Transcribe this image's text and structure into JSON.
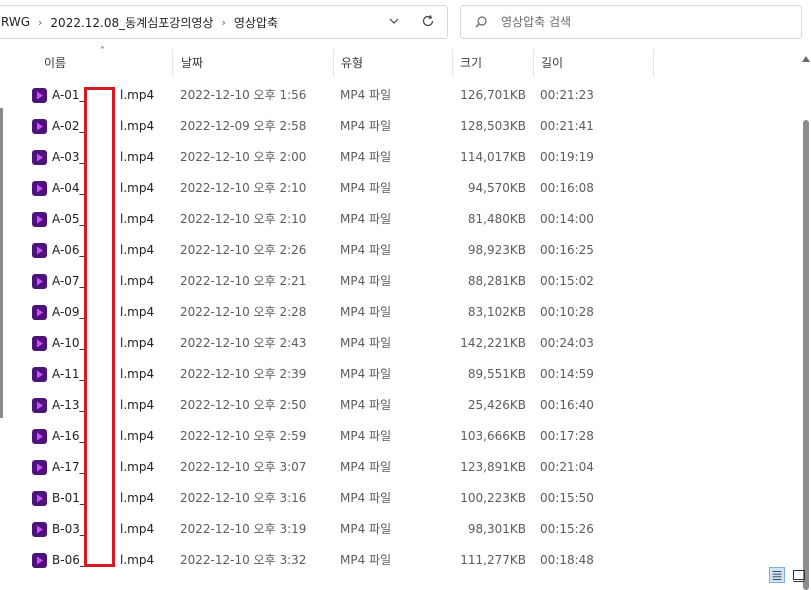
{
  "address": {
    "crumbs": [
      "RWG",
      "2022.12.08_동계심포강의영상",
      "영상압축"
    ]
  },
  "search": {
    "placeholder": "영상압축 검색"
  },
  "columns": {
    "name": "이름",
    "date": "날짜",
    "type": "유형",
    "size": "크기",
    "length": "길이"
  },
  "rows": [
    {
      "pre": "A-01_",
      "post": "l.mp4",
      "date": "2022-12-10 오후 1:56",
      "type": "MP4 파일",
      "size": "126,701KB",
      "length": "00:21:23"
    },
    {
      "pre": "A-02_",
      "post": "l.mp4",
      "date": "2022-12-09 오후 2:58",
      "type": "MP4 파일",
      "size": "128,503KB",
      "length": "00:21:41"
    },
    {
      "pre": "A-03_",
      "post": "l.mp4",
      "date": "2022-12-10 오후 2:00",
      "type": "MP4 파일",
      "size": "114,017KB",
      "length": "00:19:19"
    },
    {
      "pre": "A-04_",
      "post": "l.mp4",
      "date": "2022-12-10 오후 2:10",
      "type": "MP4 파일",
      "size": "94,570KB",
      "length": "00:16:08"
    },
    {
      "pre": "A-05_",
      "post": "l.mp4",
      "date": "2022-12-10 오후 2:10",
      "type": "MP4 파일",
      "size": "81,480KB",
      "length": "00:14:00"
    },
    {
      "pre": "A-06_",
      "post": "l.mp4",
      "date": "2022-12-10 오후 2:26",
      "type": "MP4 파일",
      "size": "98,923KB",
      "length": "00:16:25"
    },
    {
      "pre": "A-07_",
      "post": "l.mp4",
      "date": "2022-12-10 오후 2:21",
      "type": "MP4 파일",
      "size": "88,281KB",
      "length": "00:15:02"
    },
    {
      "pre": "A-09_",
      "post": "l.mp4",
      "date": "2022-12-10 오후 2:28",
      "type": "MP4 파일",
      "size": "83,102KB",
      "length": "00:10:28"
    },
    {
      "pre": "A-10_",
      "post": "l.mp4",
      "date": "2022-12-10 오후 2:43",
      "type": "MP4 파일",
      "size": "142,221KB",
      "length": "00:24:03"
    },
    {
      "pre": "A-11_",
      "post": "l.mp4",
      "date": "2022-12-10 오후 2:39",
      "type": "MP4 파일",
      "size": "89,551KB",
      "length": "00:14:59"
    },
    {
      "pre": "A-13_",
      "post": "l.mp4",
      "date": "2022-12-10 오후 2:50",
      "type": "MP4 파일",
      "size": "25,426KB",
      "length": "00:16:40"
    },
    {
      "pre": "A-16_",
      "post": "l.mp4",
      "date": "2022-12-10 오후 2:59",
      "type": "MP4 파일",
      "size": "103,666KB",
      "length": "00:17:28"
    },
    {
      "pre": "A-17_",
      "post": "l.mp4",
      "date": "2022-12-10 오후 3:07",
      "type": "MP4 파일",
      "size": "123,891KB",
      "length": "00:21:04"
    },
    {
      "pre": "B-01_",
      "post": "l.mp4",
      "date": "2022-12-10 오후 3:16",
      "type": "MP4 파일",
      "size": "100,223KB",
      "length": "00:15:50"
    },
    {
      "pre": "B-03_",
      "post": "l.mp4",
      "date": "2022-12-10 오후 3:19",
      "type": "MP4 파일",
      "size": "98,301KB",
      "length": "00:15:26"
    },
    {
      "pre": "B-06_",
      "post": "l.mp4",
      "date": "2022-12-10 오후 3:32",
      "type": "MP4 파일",
      "size": "111,277KB",
      "length": "00:18:48"
    }
  ],
  "icons": {
    "file": "video-file-icon",
    "address_dropdown": "chevron-down-icon",
    "refresh": "refresh-icon",
    "search": "search-icon",
    "sort": "sort-up-icon",
    "details_view": "details-view-icon",
    "tiles_view": "tiles-view-icon"
  },
  "colors": {
    "file_icon": "#4b1478",
    "file_icon_play": "#d24bff",
    "redaction_border": "#d71920"
  }
}
